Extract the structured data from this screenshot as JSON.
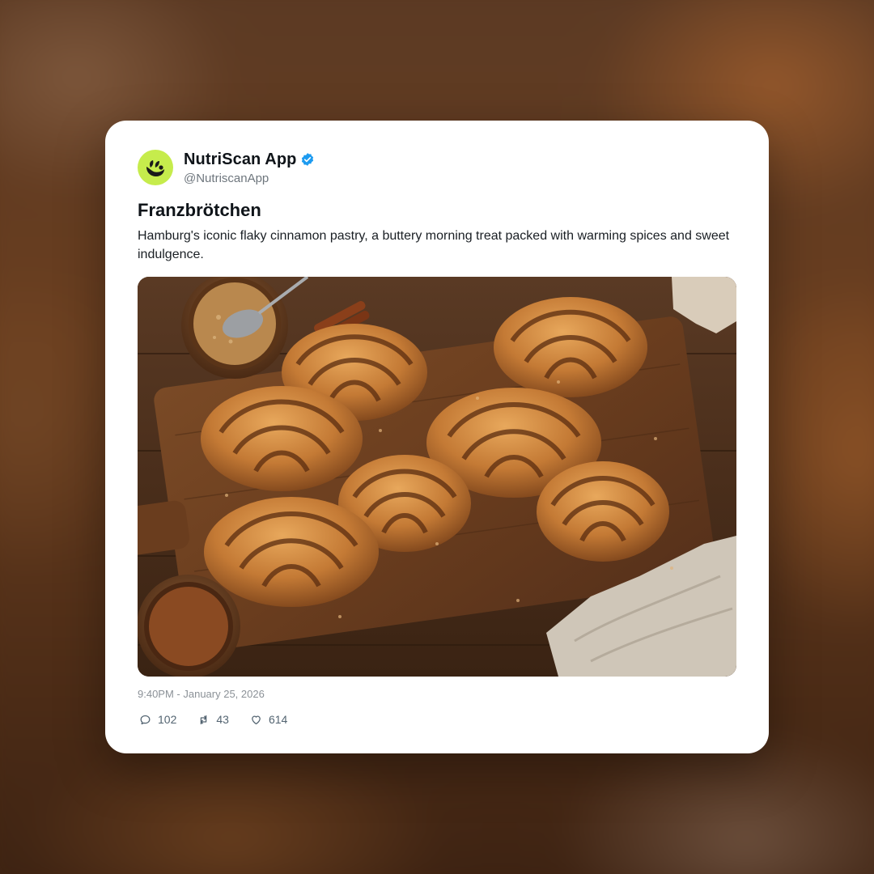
{
  "post": {
    "account": {
      "display_name": "NutriScan App",
      "handle": "@NutriscanApp",
      "verified": true,
      "avatar_icon": "leaf-logo-icon",
      "avatar_color": "#c6ec4c",
      "verified_color": "#1d9bf0"
    },
    "title": "Franzbrötchen",
    "text": "Hamburg's iconic flaky cinnamon pastry, a buttery morning treat packed with warming spices and sweet indulgence.",
    "image": {
      "subject": "cinnamon pastries on wooden board"
    },
    "timestamp": "9:40PM - January 25, 2026",
    "stats": {
      "replies": "102",
      "reposts": "43",
      "likes": "614"
    }
  }
}
